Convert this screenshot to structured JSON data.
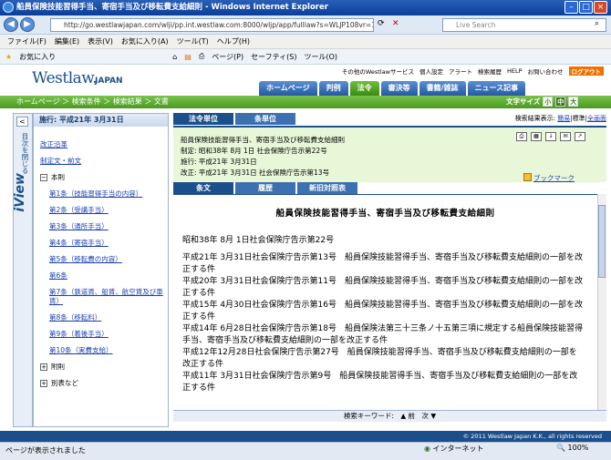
{
  "window": {
    "title": "船員保険技能習得手当、寄宿手当及び移転費支給細則 - Windows Internet Explorer"
  },
  "address": {
    "url": "http://go.westlawjapan.com/wlji/pp.int.westlaw.com:8000/wljp/app/fulllaw?s=WLJP108vr=10&srguid...",
    "search_placeholder": "Live Search"
  },
  "menu": [
    "ファイル(F)",
    "編集(E)",
    "表示(V)",
    "お気に入り(A)",
    "ツール(T)",
    "ヘルプ(H)"
  ],
  "favorites": {
    "label": "お気に入り",
    "tools": [
      "ページ(P)",
      "セーフティ(S)",
      "ツール(O)"
    ]
  },
  "header": {
    "logo": "Westlaw.",
    "logo_sub": "JAPAN",
    "toplinks": [
      "その他のWestlawサービス",
      "個人設定",
      "アラート",
      "検索履歴",
      "HELP",
      "お問い合わせ"
    ],
    "logout": "ログアウト",
    "tabs": [
      "ホームページ",
      "判例",
      "法令",
      "審決等",
      "書籍/雑誌",
      "ニュース記事"
    ],
    "active_tab": "法令"
  },
  "breadcrumb": "ホームページ ＞ 検索条件 ＞ 検索結果 ＞ 文書",
  "textsize": {
    "label": "文字サイズ",
    "options": [
      "小",
      "中",
      "大"
    ]
  },
  "iview": {
    "collapse": "<",
    "vertical": "目次を閉じる",
    "label": "iView"
  },
  "left": {
    "header": "施行: 平成21年 3月31日",
    "items": [
      "改正沿革",
      "制定文・前文"
    ],
    "main_group": "本則",
    "chapters": [
      "第1条（技能習得手当の内容）",
      "第2条（受講手当）",
      "第3条（通所手当）",
      "第4条（寄宿手当）",
      "第5条（移転費の内容）",
      "第6条",
      "第7条（鉄道賃、船賃、航空賃及び車賃）",
      "第8条（移転料）",
      "第9条（着後手当）",
      "第10条（実費支給）"
    ],
    "tail": [
      "附則",
      "別表など"
    ]
  },
  "main": {
    "tabs": [
      "法令単位",
      "条単位"
    ],
    "result_display": {
      "label": "検索結果表示:",
      "options": [
        "簡易",
        "標準",
        "全画面"
      ]
    },
    "info": {
      "title": "船員保険技能習得手当、寄宿手当及び移転費支給細則",
      "enacted": "制定: 昭和38年 8月 1日 社会保険庁告示第22号",
      "effective": "施行: 平成21年 3月31日",
      "amended": "改正: 平成21年 3月31日 社会保険庁告示第13号"
    },
    "bookmark": "ブックマーク",
    "subtabs": [
      "条文",
      "履歴",
      "新旧対照表"
    ],
    "doc": {
      "title": "船員保険技能習得手当、寄宿手当及び移転費支給細則",
      "date": "昭和38年 8月 1日社会保険庁告示第22号",
      "amendments": [
        "平成21年 3月31日社会保険庁告示第13号　船員保険技能習得手当、寄宿手当及び移転費支給細則の一部を改正する件",
        "平成20年 3月31日社会保険庁告示第11号　船員保険技能習得手当、寄宿手当及び移転費支給細則の一部を改正する件",
        "平成15年 4月30日社会保険庁告示第16号　船員保険技能習得手当、寄宿手当及び移転費支給細則の一部を改正する件",
        "平成14年 6月28日社会保険庁告示第18号　船員保険法第三十三条ノ十五第三項に規定する船員保険技能習得手当、寄宿手当及び移転費支給細則の一部を改正する件",
        "平成12年12月28日社会保険庁告示第27号　船員保険技能習得手当、寄宿手当及び移転費支給細則の一部を改正する件",
        "平成11年 3月31日社会保険庁告示第9号　船員保険技能習得手当、寄宿手当及び移転費支給細則の一部を改正する件"
      ]
    },
    "search_keyword": "検索キーワード:　▲ 前　次 ▼"
  },
  "copyright": "© 2011 Westlaw Japan K.K., all rights reserved",
  "status": {
    "text": "ページが表示されました",
    "zone": "インターネット",
    "zoom": "100%"
  }
}
